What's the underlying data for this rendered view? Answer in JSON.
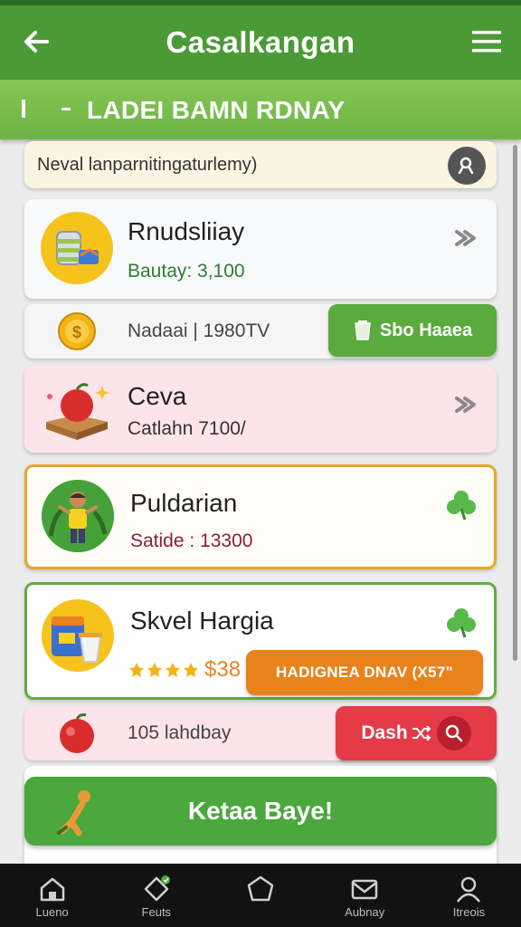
{
  "header": {
    "title": "Casalkangan"
  },
  "banner": {
    "text": "LADEI BAMN RDNAY"
  },
  "search": {
    "placeholder": "Neval lanparnitingaturlemy)"
  },
  "items": [
    {
      "title": "Rnudsliiay",
      "subtitle": "Bautay: 3,100"
    },
    {
      "title": "Ceva",
      "subtitle": "Catlahn 7100/"
    },
    {
      "title": "Puldarian",
      "subtitle": "Satide : 13300"
    },
    {
      "title": "Skvel Hargia",
      "price": "$38"
    }
  ],
  "row1": {
    "label": "Nadaai | 1980TV",
    "button": "Sbo Haaea"
  },
  "promo": {
    "button": "HADIGNEA DNAV (X57\""
  },
  "row2": {
    "label": "105 lahdbay",
    "button": "Dash"
  },
  "cta": {
    "label": "Ketaa Baye!"
  },
  "nav": [
    {
      "label": "Lueno",
      "icon": "home-icon"
    },
    {
      "label": "Feuts",
      "icon": "tag-icon"
    },
    {
      "label": "",
      "icon": "pentagon-icon"
    },
    {
      "label": "Aubnay",
      "icon": "mail-icon"
    },
    {
      "label": "Itreois",
      "icon": "profile-icon"
    }
  ],
  "colors": {
    "primary": "#4c9a35",
    "banner": "#78bb4b",
    "orange": "#e8831c",
    "red": "#e53a48",
    "pink_card": "#fde4ea"
  }
}
